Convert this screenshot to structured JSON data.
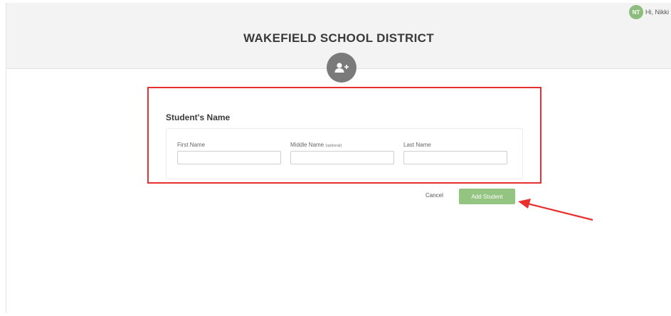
{
  "header": {
    "title": "WAKEFIELD SCHOOL DISTRICT",
    "user": {
      "initials": "NT",
      "greeting": "Hi, Nikki"
    },
    "add_user_icon": "add-user-icon"
  },
  "form": {
    "section_title": "Student's Name",
    "fields": [
      {
        "label": "First Name",
        "value": "",
        "placeholder": ""
      },
      {
        "label": "Middle Name",
        "note": "(optional)",
        "value": "",
        "placeholder": ""
      },
      {
        "label": "Last Name",
        "value": "",
        "placeholder": ""
      }
    ]
  },
  "actions": {
    "cancel_label": "Cancel",
    "submit_label": "Add Student"
  },
  "colors": {
    "header_bg": "#f3f3f3",
    "accent_green": "#94c482",
    "avatar_green": "#8bbd7c",
    "annotation_red": "#e8312f",
    "icon_gray": "#7a7a7a"
  }
}
